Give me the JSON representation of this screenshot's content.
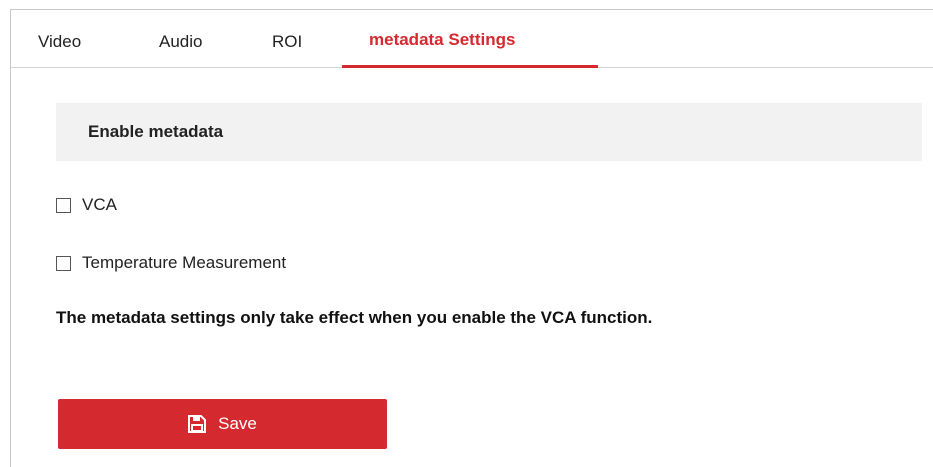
{
  "tabs": [
    {
      "label": "Video",
      "active": false
    },
    {
      "label": "Audio",
      "active": false
    },
    {
      "label": "ROI",
      "active": false
    },
    {
      "label": "metadata Settings",
      "active": true
    }
  ],
  "section": {
    "title": "Enable metadata"
  },
  "options": [
    {
      "label": "VCA",
      "checked": false
    },
    {
      "label": "Temperature Measurement",
      "checked": false
    }
  ],
  "note": "The metadata settings only take effect when you enable the VCA function.",
  "save_button": {
    "label": "Save",
    "icon": "save-icon"
  },
  "colors": {
    "accent": "#d42a2f",
    "section_background": "#f2f2f2"
  }
}
